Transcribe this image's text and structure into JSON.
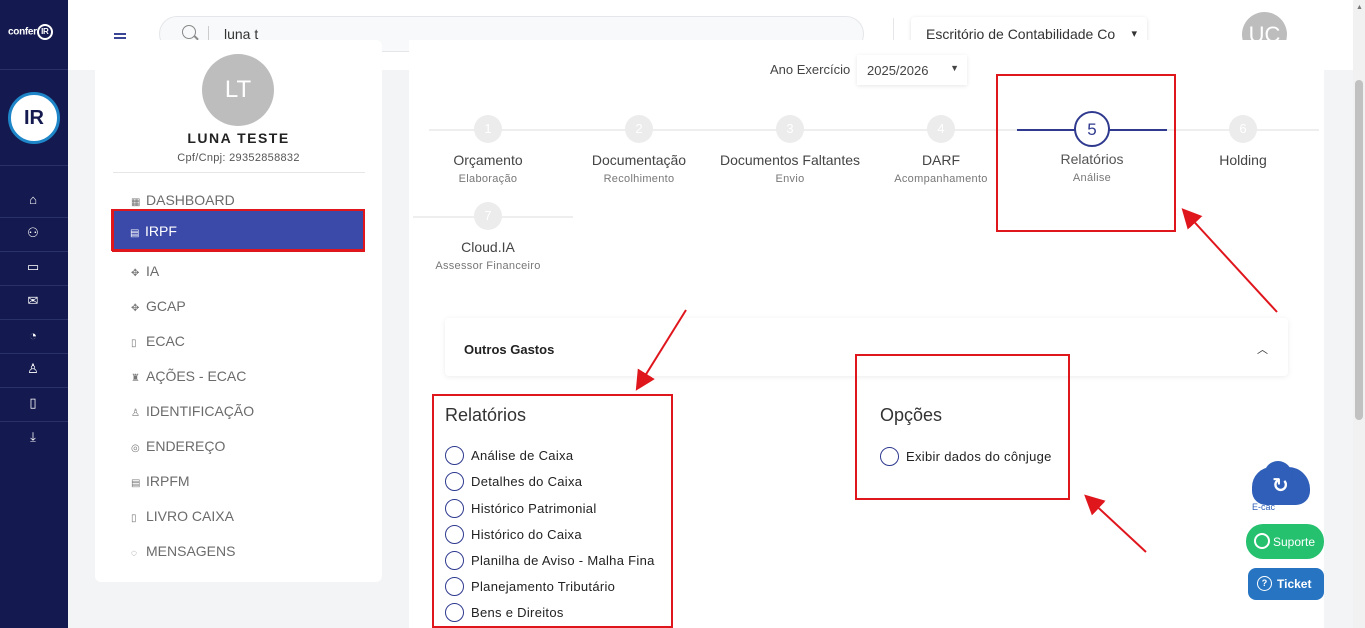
{
  "header": {
    "search_value": "luna t",
    "office_select": "Escritório de Contabilidade Co",
    "user_initials": "UC"
  },
  "rail": {
    "logo_text": "confer",
    "logo_badge": "IR",
    "brand_badge": "IR",
    "icons": [
      "home-icon",
      "users-icon",
      "card-icon",
      "mail-icon",
      "pie-chart-icon",
      "user-cog-icon",
      "file-icon",
      "download-icon"
    ]
  },
  "client": {
    "initials": "LT",
    "name": "LUNA TESTE",
    "cpf": "Cpf/Cnpj: 29352858832"
  },
  "sidebar": {
    "items": [
      {
        "label": "DASHBOARD",
        "icon": "dashboard-icon"
      },
      {
        "label": "IRPF",
        "icon": "file-icon",
        "active": true
      },
      {
        "label": "IA",
        "icon": "grid-icon"
      },
      {
        "label": "GCAP",
        "icon": "grid-icon"
      },
      {
        "label": "ECAC",
        "icon": "book-icon"
      },
      {
        "label": "AÇÕES - ECAC",
        "icon": "robot-icon"
      },
      {
        "label": "IDENTIFICAÇÃO",
        "icon": "user-icon"
      },
      {
        "label": "ENDEREÇO",
        "icon": "location-icon"
      },
      {
        "label": "IRPFM",
        "icon": "file-icon"
      },
      {
        "label": "LIVRO CAIXA",
        "icon": "book-icon"
      },
      {
        "label": "MENSAGENS",
        "icon": "chat-icon"
      }
    ]
  },
  "main": {
    "year_label": "Ano Exercício",
    "year_value": "2025/2026",
    "steps": [
      {
        "num": "1",
        "label": "Orçamento",
        "sub": "Elaboração"
      },
      {
        "num": "2",
        "label": "Documentação",
        "sub": "Recolhimento"
      },
      {
        "num": "3",
        "label": "Documentos Faltantes",
        "sub": "Envio"
      },
      {
        "num": "4",
        "label": "DARF",
        "sub": "Acompanhamento"
      },
      {
        "num": "5",
        "label": "Relatórios",
        "sub": "Análise",
        "current": true
      },
      {
        "num": "6",
        "label": "Holding",
        "sub": ""
      },
      {
        "num": "7",
        "label": "Cloud.IA",
        "sub": "Assessor Financeiro"
      }
    ],
    "accordion_title": "Outros Gastos",
    "reports_title": "Relatórios",
    "reports": [
      "Análise de Caixa",
      "Detalhes do Caixa",
      "Histórico Patrimonial",
      "Histórico do Caixa",
      "Planilha de Aviso - Malha Fina",
      "Planejamento Tributário",
      "Bens e Direitos"
    ],
    "options_title": "Opções",
    "options": [
      "Exibir dados do cônjuge"
    ]
  },
  "floating": {
    "ecac_label": "E-cac",
    "support_label": "Suporte",
    "ticket_label": "Ticket"
  },
  "colors": {
    "rail": "#141a4f",
    "accent": "#3b4aa8",
    "annotation": "#e0161d",
    "support": "#25c16f",
    "ticket": "#2775c2"
  }
}
